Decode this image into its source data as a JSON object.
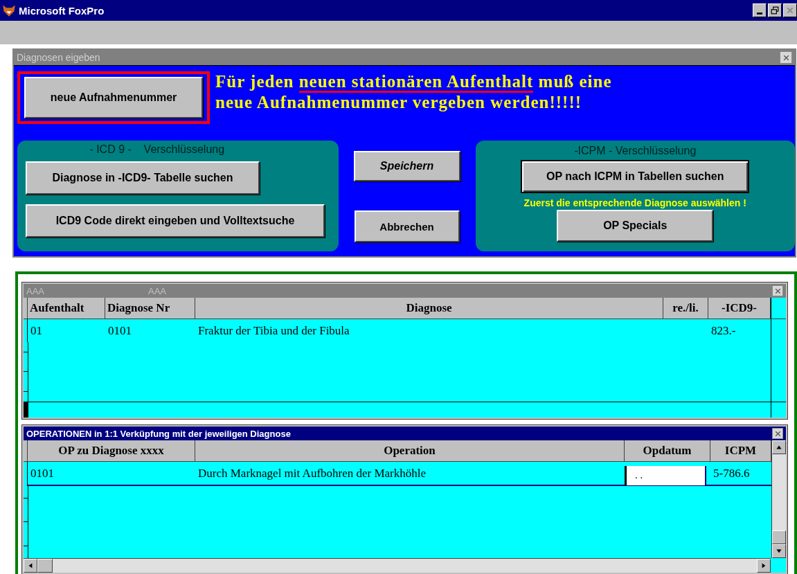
{
  "app": {
    "title": "Microsoft FoxPro"
  },
  "dialog": {
    "title": "Diagnosen eigeben",
    "new_button": "neue Aufnahmenummer",
    "notice": [
      {
        "text": "Für jeden ",
        "underline": false
      },
      {
        "text": "neuen stationären Aufenthalt",
        "underline": true
      },
      {
        "text": " muß eine neue Aufnahmenummer vergeben werden!!!!!",
        "underline": false
      }
    ],
    "icd_group": {
      "title": "- ICD 9 -    Verschlüsselung",
      "buttons": [
        "Diagnose in -ICD9- Tabelle suchen",
        "ICD9 Code direkt eingeben und Volltextsuche"
      ]
    },
    "middle_buttons": [
      {
        "label": "Speichern",
        "kind": "italic"
      },
      {
        "label": "Abbrechen",
        "kind": "plain"
      }
    ],
    "icpm_group": {
      "title": "-ICPM - Verschlüsselung",
      "search_button": "OP nach ICPM in Tabellen suchen",
      "hint": "Zuerst die entsprechende Diagnose auswählen !",
      "specials_button": "OP Specials"
    }
  },
  "diagnoses": {
    "title": [
      "AAA",
      "AAA"
    ],
    "columns": [
      "Aufenthalt",
      "Diagnose Nr",
      "Diagnose",
      "re./li.",
      "-ICD9-"
    ],
    "rows": [
      {
        "aufenthalt": "01",
        "diagnose_nr": "0101",
        "diagnose": "Fraktur der Tibia und der Fibula",
        "icd9": "823.-"
      }
    ]
  },
  "operations": {
    "title": "OPERATIONEN in 1:1 Verküpfung mit der jeweiligen Diagnose",
    "columns": [
      "OP zu Diagnose xxxx",
      "Operation",
      "Opdatum",
      "ICPM"
    ],
    "rows": [
      {
        "op": "0101",
        "operation": "Durch Marknagel mit Aufbohren der Markhöhle",
        "opdatum": ". .",
        "icpm": "5-786.6"
      }
    ]
  }
}
